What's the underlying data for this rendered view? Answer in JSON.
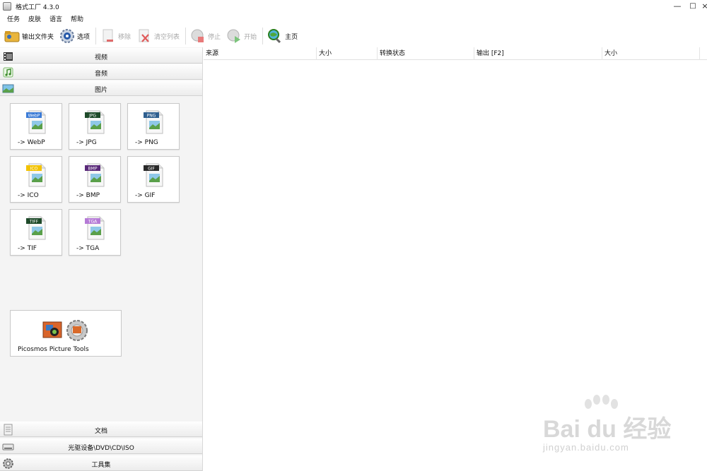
{
  "window": {
    "title": "格式工厂 4.3.0",
    "controls": {
      "minimize": "—",
      "maximize": "□",
      "close": "×"
    }
  },
  "menubar": {
    "items": [
      "任务",
      "皮肤",
      "语言",
      "帮助"
    ]
  },
  "toolbar": {
    "output_folder": "输出文件夹",
    "options": "选项",
    "remove": "移除",
    "clear_list": "清空列表",
    "stop": "停止",
    "start": "开始",
    "home": "主页"
  },
  "categories": {
    "video": "视频",
    "audio": "音频",
    "picture": "图片",
    "document": "文档",
    "optical": "光驱设备\\DVD\\CD\\ISO",
    "tools": "工具集"
  },
  "picture_tiles": [
    {
      "badge": "WebP",
      "label": "-> WebP",
      "color": "#3b7bd6"
    },
    {
      "badge": "JPG",
      "label": "-> JPG",
      "color": "#1e4a2a"
    },
    {
      "badge": "PNG",
      "label": "-> PNG",
      "color": "#2f5f8f"
    },
    {
      "badge": "ICO",
      "label": "-> ICO",
      "color": "#f2c200"
    },
    {
      "badge": "BMP",
      "label": "-> BMP",
      "color": "#5a2a7a"
    },
    {
      "badge": "GIF",
      "label": "-> GIF",
      "color": "#2a2a2a"
    },
    {
      "badge": "TIFF",
      "label": "-> TIF",
      "color": "#1e4a2a"
    },
    {
      "badge": "TGA",
      "label": "-> TGA",
      "color": "#b57ad6"
    }
  ],
  "picosmos": {
    "label": "Picosmos Picture Tools"
  },
  "list_columns": [
    "来源",
    "大小",
    "转换状态",
    "输出 [F2]",
    "大小"
  ],
  "watermark": {
    "brand": "Bai du 经验",
    "url": "jingyan.baidu.com"
  }
}
